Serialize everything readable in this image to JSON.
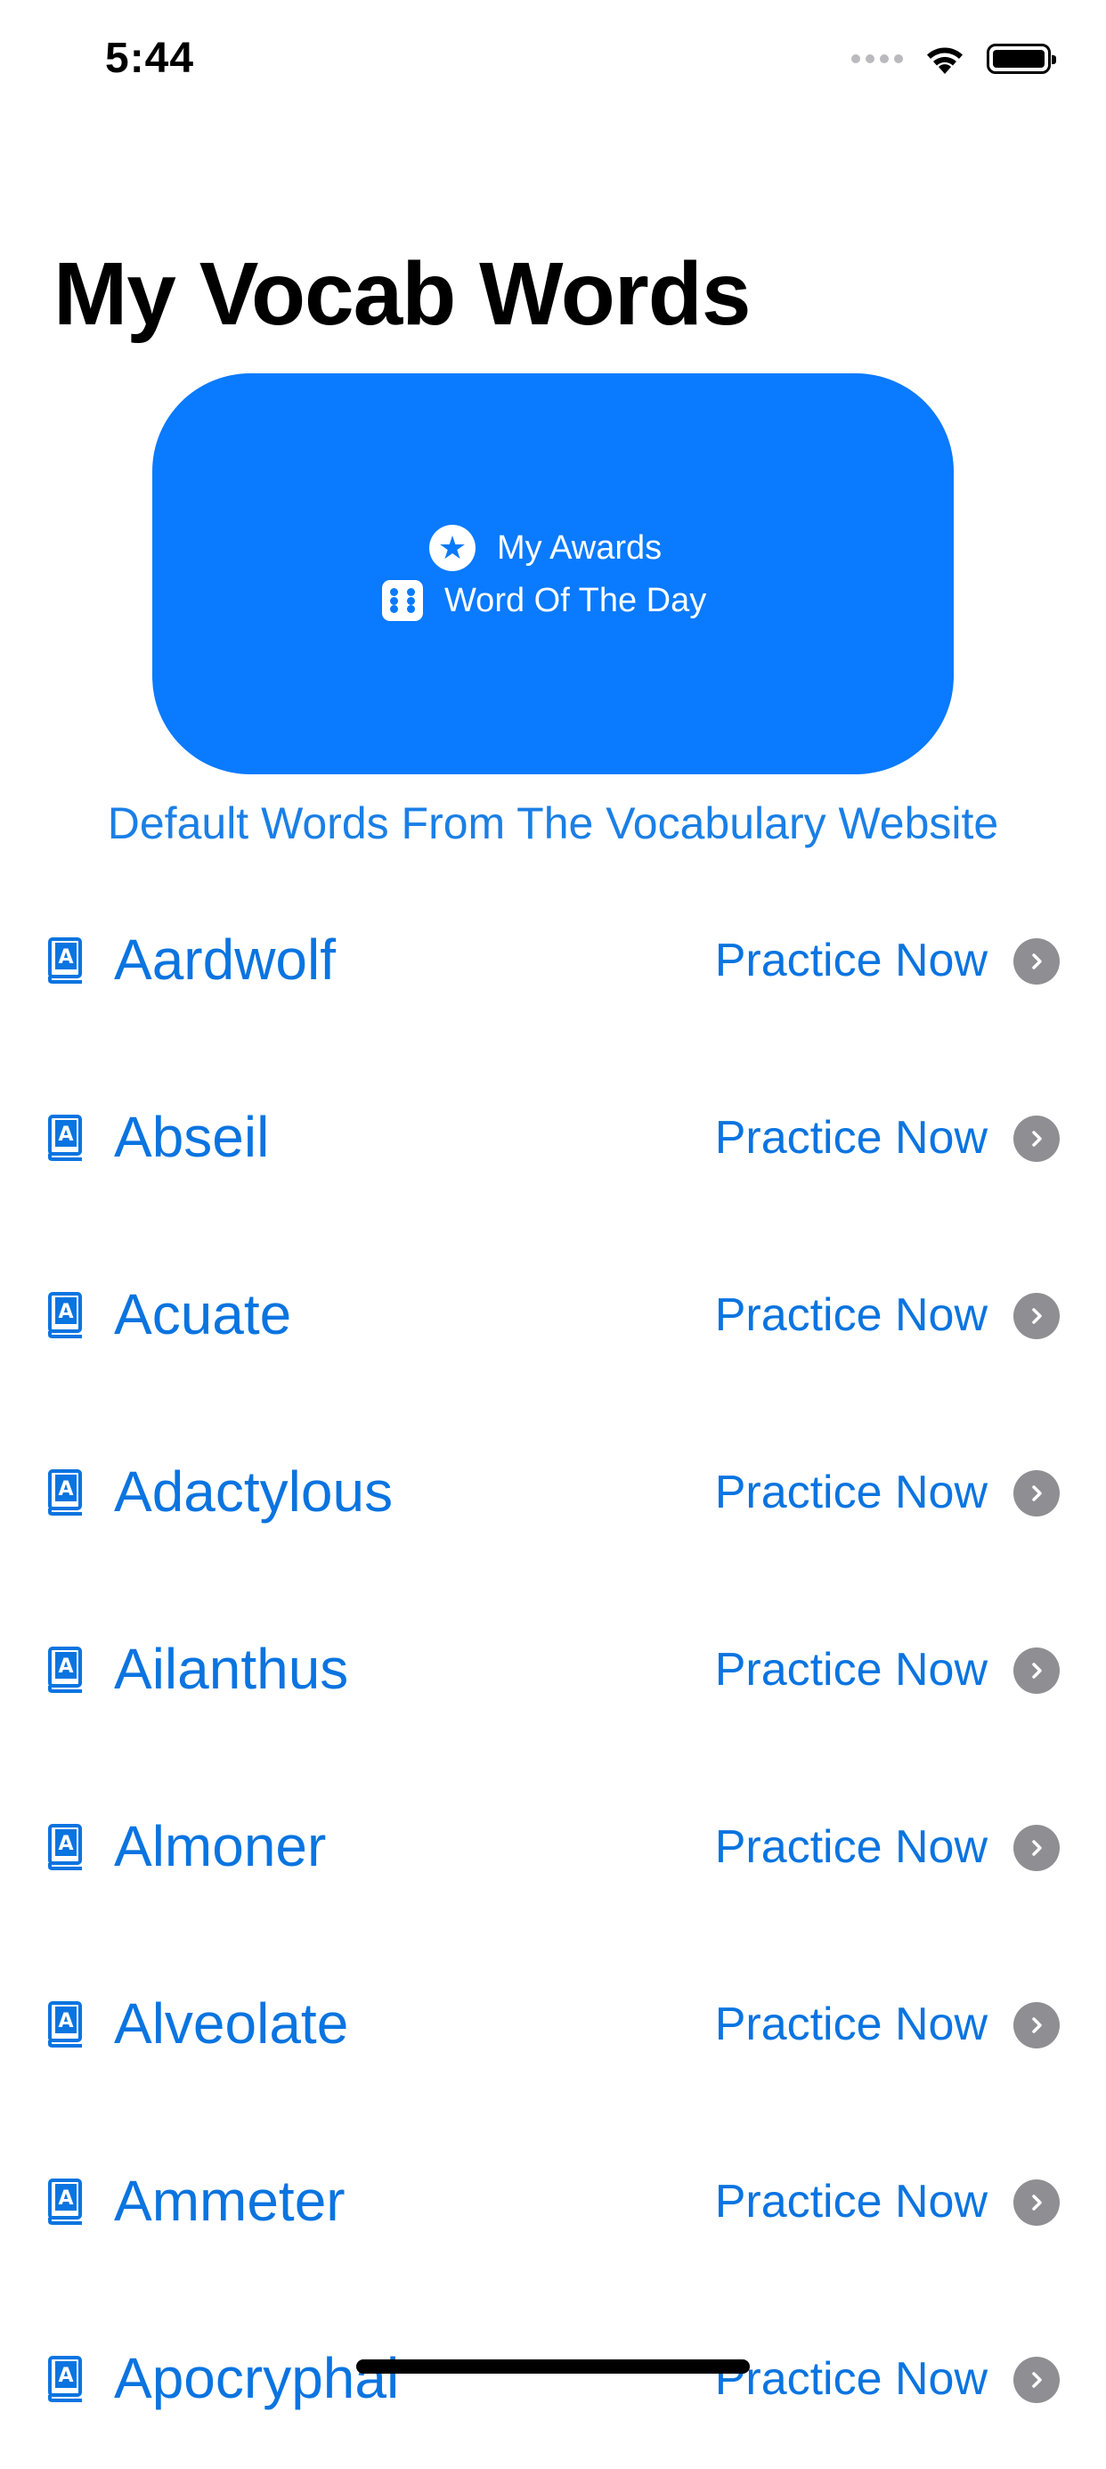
{
  "status_bar": {
    "time": "5:44"
  },
  "header": {
    "title": "My Vocab Words"
  },
  "menu": {
    "awards_label": "My Awards",
    "word_of_day_label": "Word Of The Day",
    "color": "#0a7aff"
  },
  "source_link": "Default Words From The Vocabulary Website",
  "words": [
    {
      "word": "Aardwolf",
      "action": "Practice Now"
    },
    {
      "word": "Abseil",
      "action": "Practice Now"
    },
    {
      "word": "Acuate",
      "action": "Practice Now"
    },
    {
      "word": "Adactylous",
      "action": "Practice Now"
    },
    {
      "word": "Ailanthus",
      "action": "Practice Now"
    },
    {
      "word": "Almoner",
      "action": "Practice Now"
    },
    {
      "word": "Alveolate",
      "action": "Practice Now"
    },
    {
      "word": "Ammeter",
      "action": "Practice Now"
    },
    {
      "word": "Apocryphal",
      "action": "Practice Now"
    }
  ],
  "icons": {
    "word_icon": "book-icon",
    "row_chevron": "chevron-right-icon"
  }
}
